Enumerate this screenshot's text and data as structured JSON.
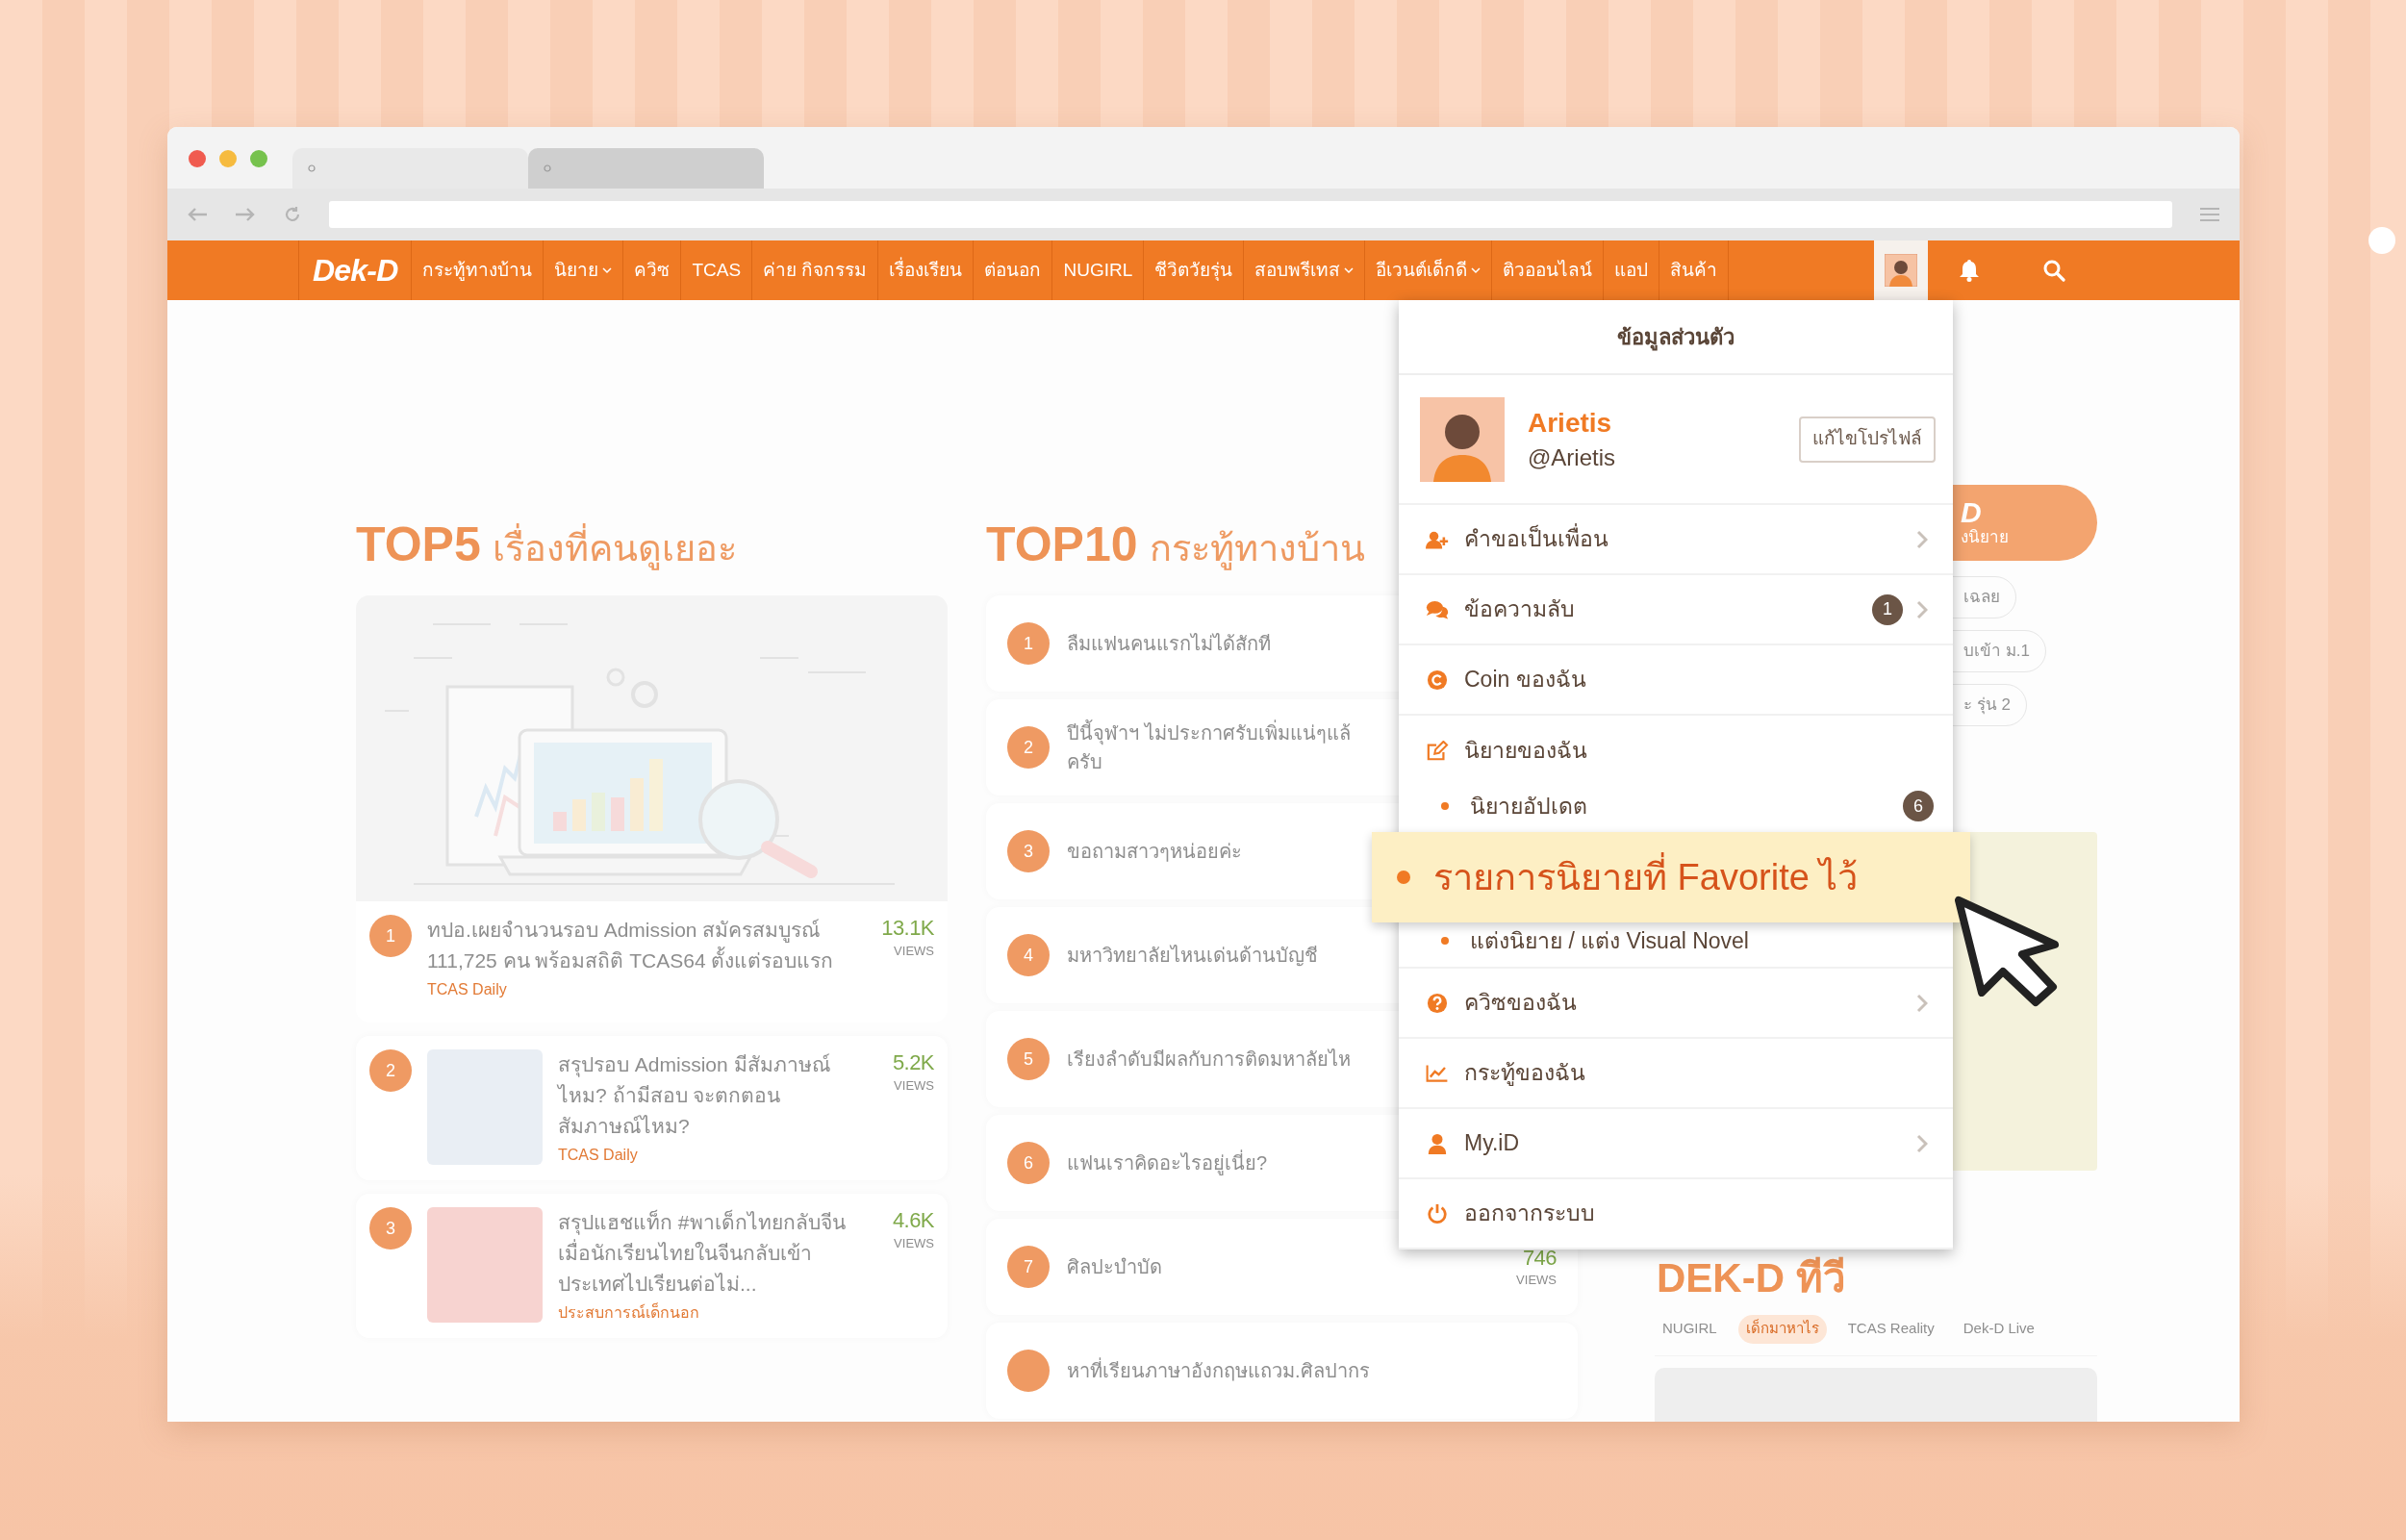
{
  "browser": {
    "tabs": [
      {
        "selected": true
      },
      {
        "selected": false
      }
    ]
  },
  "nav": {
    "logo": "Dek-D",
    "items": [
      {
        "label": "กระทู้ทางบ้าน",
        "has_menu": false
      },
      {
        "label": "นิยาย",
        "has_menu": true
      },
      {
        "label": "ควิซ",
        "has_menu": false
      },
      {
        "label": "TCAS",
        "has_menu": false
      },
      {
        "label": "ค่าย กิจกรรม",
        "has_menu": false
      },
      {
        "label": "เรื่องเรียน",
        "has_menu": false
      },
      {
        "label": "ต่อนอก",
        "has_menu": false
      },
      {
        "label": "NUGIRL",
        "has_menu": false
      },
      {
        "label": "ชีวิตวัยรุ่น",
        "has_menu": false
      },
      {
        "label": "สอบพรีเทส",
        "has_menu": true
      },
      {
        "label": "อีเวนต์เด็กดี",
        "has_menu": true
      },
      {
        "label": "ติวออนไลน์",
        "has_menu": false
      },
      {
        "label": "แอป",
        "has_menu": false
      },
      {
        "label": "สินค้า",
        "has_menu": false
      }
    ],
    "profile_button": {
      "selected": true
    }
  },
  "top5": {
    "label": "TOP5",
    "title": "เรื่องที่คนดูเยอะ",
    "items": [
      {
        "kind": "featured",
        "rank": "1",
        "title": "ทปอ.เผยจำนวนรอบ Admission สมัครสมบูรณ์ 111,725 คน พร้อมสถิติ TCAS64 ตั้งแต่รอบแรก",
        "source": "TCAS Daily",
        "views": "13.1K",
        "views_label": "VIEWS"
      },
      {
        "kind": "thumb",
        "rank": "2",
        "color": "#e9eef4",
        "title": "สรุปรอบ Admission มีสัมภาษณ์ไหม? ถ้ามีสอบ จะตกตอนสัมภาษณ์ไหม?",
        "source": "TCAS Daily",
        "views": "5.2K",
        "views_label": "VIEWS"
      },
      {
        "kind": "thumb",
        "rank": "3",
        "color": "#f7d3d0",
        "title": "สรุปแฮชแท็ก #พาเด็กไทยกลับจีน เมื่อนักเรียนไทยในจีนกลับเข้าประเทศไปเรียนต่อไม่...",
        "source": "ประสบการณ์เด็กนอก",
        "views": "4.6K",
        "views_label": "VIEWS"
      }
    ]
  },
  "top10": {
    "label": "TOP10",
    "title": "กระทู้ทางบ้าน",
    "items": [
      {
        "rank": "1",
        "title": "ลืมแฟนคนแรกไม่ได้สักที"
      },
      {
        "rank": "2",
        "title": "ปีนี้จุฬาฯ ไม่ประกาศรับเพิ่มแน่ๆแล้\nครับ"
      },
      {
        "rank": "3",
        "title": "ขอถามสาวๆหน่อยค่ะ"
      },
      {
        "rank": "4",
        "title": "มหาวิทยาลัยไหนเด่นด้านบัญชี"
      },
      {
        "rank": "5",
        "title": "เรียงลำดับมีผลกับการติดมหาลัยไห"
      },
      {
        "rank": "6",
        "title": "แฟนเราคิดอะไรอยู่เนี่ย?"
      },
      {
        "rank": "7",
        "title": "ศิลปะบำบัด",
        "views": "746",
        "views_label": "VIEWS"
      },
      {
        "title": "หาที่เรียนภาษาอังกฤษแถวม.ศิลปากร"
      }
    ]
  },
  "sidebar": {
    "button": {
      "title": "D",
      "subtitle": "งนิยาย"
    },
    "tags": [
      "เฉลย",
      "บเข้า ม.1",
      "ะ รุ่น 2"
    ],
    "tv": {
      "title": "DEK-D ทีวี",
      "tabs": [
        {
          "label": "NUGIRL",
          "selected": false
        },
        {
          "label": "เด็กมาหาไร",
          "selected": true
        },
        {
          "label": "TCAS Reality",
          "selected": false
        },
        {
          "label": "Dek-D Live",
          "selected": false
        }
      ]
    }
  },
  "profile_menu": {
    "title": "ข้อมูลส่วนตัว",
    "user": {
      "name": "Arietis",
      "handle": "@Arietis"
    },
    "edit_button": "แก้ไขโปรไฟล์",
    "items": [
      {
        "kind": "link",
        "label": "คำขอเป็นเพื่อน",
        "has_arrow": true
      },
      {
        "kind": "link",
        "label": "ข้อความลับ",
        "badge": "1",
        "has_arrow": true
      },
      {
        "kind": "link",
        "label": "Coin ของฉัน",
        "has_arrow": false
      },
      {
        "kind": "group",
        "label": "นิยายของฉัน",
        "has_arrow": false
      },
      {
        "kind": "sub",
        "label": "นิยายอัปเดต",
        "badge": "6",
        "highlighted": false
      },
      {
        "kind": "sub",
        "label": "รายการนิยายที่ Favorite ไว้",
        "highlighted": true
      },
      {
        "kind": "sub",
        "label": "แต่งนิยาย / แต่ง Visual Novel",
        "highlighted": false
      },
      {
        "kind": "link",
        "label": "ควิซของฉัน",
        "has_arrow": true
      },
      {
        "kind": "link",
        "label": "กระทู้ของฉัน",
        "has_arrow": false
      },
      {
        "kind": "link",
        "label": "My.iD",
        "has_arrow": true
      },
      {
        "kind": "link",
        "label": "ออกจากระบบ",
        "has_arrow": false
      }
    ]
  }
}
